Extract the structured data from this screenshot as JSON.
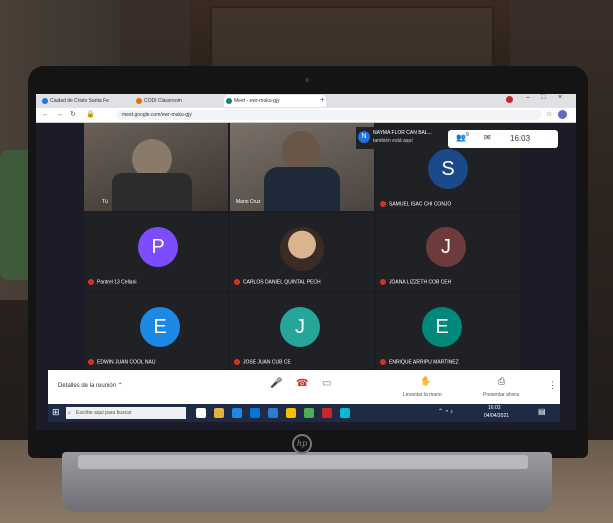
{
  "browser": {
    "tabs": [
      {
        "label": "Ciudad de Cristo Santa Fe",
        "icon_color": "#1a73e8"
      },
      {
        "label": "CODI Classroom",
        "icon_color": "#e37400"
      },
      {
        "label": "Meet - ewr-muku-gjy",
        "icon_color": "#00897b"
      }
    ],
    "url": "meet.google.com/ewr-muku-gjy"
  },
  "meet": {
    "notification": {
      "initial": "N",
      "title": "NAYMA FLOR CAN BAL...",
      "subtitle": "también está aquí"
    },
    "time": "16:03",
    "participant_count": "9",
    "participants": [
      {
        "name": "Tú",
        "type": "video"
      },
      {
        "name": "Mario Cruz",
        "type": "video"
      },
      {
        "name": "SAMUEL ISAC CHI CONJO",
        "initial": "S",
        "color": "#1a4a8a",
        "muted": true
      },
      {
        "name": "Pantrel 13 Cellani",
        "initial": "P",
        "color": "#7c4dff",
        "muted": true
      },
      {
        "name": "CARLOS DANIEL QUINTAL PECH",
        "type": "photo",
        "muted": true
      },
      {
        "name": "JOANA LIZZETH COB CEH",
        "initial": "J",
        "color": "#6d3b3b",
        "muted": true
      },
      {
        "name": "EDWIN JUAN COOL NAU",
        "initial": "E",
        "color": "#1e88e5",
        "muted": true
      },
      {
        "name": "JOSE JUAN CUB CE",
        "initial": "J",
        "color": "#26a69a",
        "muted": true
      },
      {
        "name": "ENRIQUE ARRIPU MARTINEZ",
        "initial": "E",
        "color": "#00897b",
        "muted": true
      }
    ],
    "details_label": "Detalles de la reunión",
    "present_label": "Presentar ahora",
    "raise_hand_label": "Levantar la mano"
  },
  "taskbar": {
    "search_placeholder": "Escribe aquí para buscar",
    "clock_time": "16:03",
    "clock_date": "04/04/2021"
  },
  "laptop": {
    "brand": "hp"
  }
}
